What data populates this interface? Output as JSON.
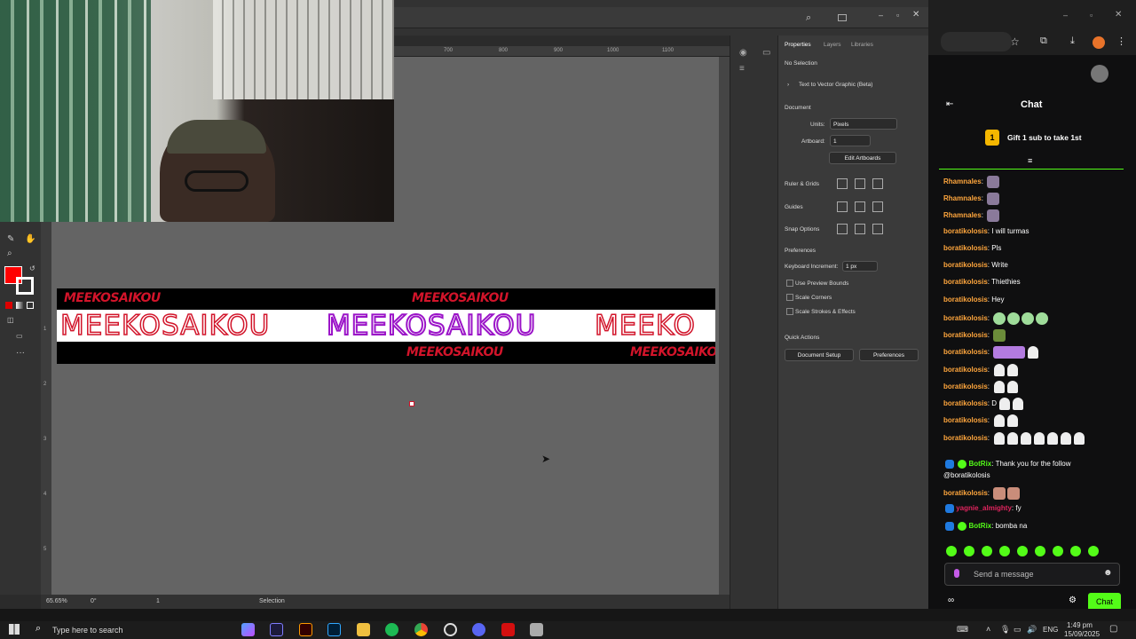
{
  "illustrator": {
    "ruler_top_ticks": [
      "700",
      "800",
      "900",
      "1000",
      "1100"
    ],
    "ruler_left_ticks": [
      "1",
      "2",
      "3",
      "4",
      "5"
    ],
    "status": {
      "zoom": "65.65%",
      "rotate": "0°",
      "artboard": "1",
      "tool": "Selection"
    },
    "properties": {
      "tabs": [
        "Properties",
        "Layers",
        "Libraries"
      ],
      "selection": "No Selection",
      "text_to_vector": "Text to Vector Graphic (Beta)",
      "document_heading": "Document",
      "units_label": "Units:",
      "units_value": "Pixels",
      "artboard_label": "Artboard:",
      "artboard_value": "1",
      "edit_artboards": "Edit Artboards",
      "ruler_grids": "Ruler & Grids",
      "guides": "Guides",
      "snap_options": "Snap Options",
      "preferences_heading": "Preferences",
      "keyboard_increment_label": "Keyboard Increment:",
      "keyboard_increment_value": "1 px",
      "check_preview_bounds": "Use Preview Bounds",
      "check_scale_corners": "Scale Corners",
      "check_scale_strokes": "Scale Strokes & Effects",
      "quick_actions": "Quick Actions",
      "document_setup": "Document Setup",
      "preferences_button": "Preferences"
    },
    "banner": {
      "small_text": "MEEKOSAIKOU",
      "big_text": "MEEKOSAIKOU",
      "cut_text": "MEEKO",
      "colors": {
        "red": "#d2142a",
        "purple": "#9b14c8"
      }
    }
  },
  "chat": {
    "title": "Chat",
    "gift_text": "Gift 1 sub to take 1st",
    "gift_badge": "1",
    "messages": [
      {
        "user": "Rhamnales",
        "text": ""
      },
      {
        "user": "Rhamnales",
        "text": ""
      },
      {
        "user": "Rhamnales",
        "text": ""
      },
      {
        "user": "boratikolosis",
        "text": "I will turmas"
      },
      {
        "user": "boratikolosis",
        "text": "Pls"
      },
      {
        "user": "boratikolosis",
        "text": "Write"
      },
      {
        "user": "boratikolosis",
        "text": "Thiethies"
      },
      {
        "user": "boratikolosis",
        "text": "Hey"
      },
      {
        "user": "boratikolosis",
        "text": ""
      },
      {
        "user": "boratikolosis",
        "text": ""
      },
      {
        "user": "boratikolosis",
        "text": ""
      },
      {
        "user": "boratikolosis",
        "text": ""
      },
      {
        "user": "boratikolosis",
        "text": ""
      },
      {
        "user": "boratikolosis",
        "text": "D"
      },
      {
        "user": "boratikolosis",
        "text": ""
      },
      {
        "user": "boratikolosis",
        "text": ""
      }
    ],
    "botrix_1_user": "BotRix",
    "botrix_1_text": "Thank you for the follow",
    "botrix_1_mention": "@boratikolosis",
    "after_botrix_user": "boratikolosis",
    "yagnie_user": "yagnie_almighty",
    "yagnie_text": "fy",
    "botrix_2_user": "BotRix",
    "botrix_2_text": "bomba na",
    "input_placeholder": "Send a message",
    "chat_button": "Chat"
  },
  "taskbar": {
    "search_placeholder": "Type here to search",
    "language": "ENG",
    "time": "1:49 pm",
    "date": "15/09/2025"
  }
}
